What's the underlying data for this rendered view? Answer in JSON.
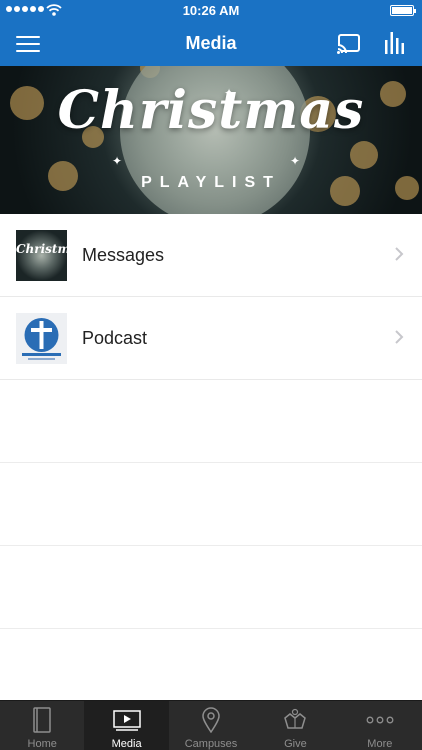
{
  "status_bar": {
    "time": "10:26 AM"
  },
  "nav": {
    "title": "Media",
    "accent_color": "#1a72c4"
  },
  "banner": {
    "title": "Christmas",
    "subtitle": "PLAYLIST"
  },
  "list": {
    "items": [
      {
        "label": "Messages",
        "thumbnail": "christmas-playlist-artwork",
        "thumb_text": "Christmas"
      },
      {
        "label": "Podcast",
        "thumbnail": "podcast-cross-artwork"
      }
    ]
  },
  "tabbar": {
    "tabs": [
      {
        "label": "Home",
        "icon": "book-icon",
        "active": false
      },
      {
        "label": "Media",
        "icon": "play-icon",
        "active": true
      },
      {
        "label": "Campuses",
        "icon": "map-pin-icon",
        "active": false
      },
      {
        "label": "Give",
        "icon": "hands-icon",
        "active": false
      },
      {
        "label": "More",
        "icon": "more-dots-icon",
        "active": false
      }
    ]
  }
}
